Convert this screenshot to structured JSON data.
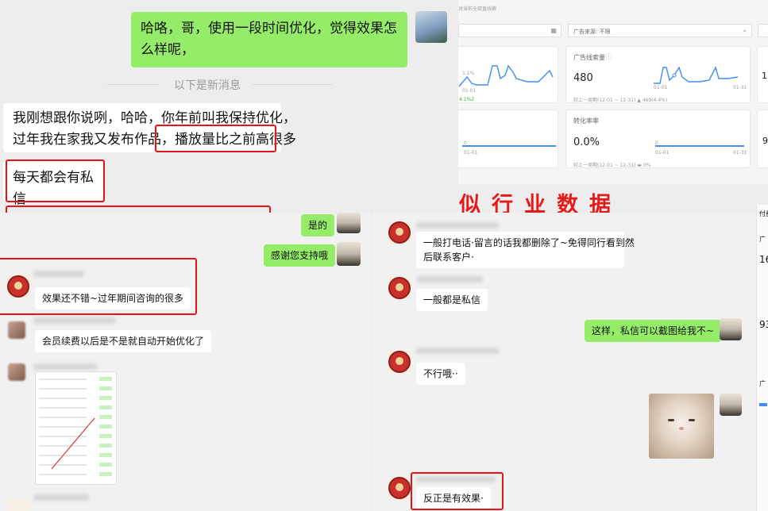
{
  "chat_top": {
    "outgoing": "哈咯，哥，使用一段时间优化，觉得效果怎么样呢，",
    "divider": "以下是新消息",
    "incoming_1_line1": "我刚想跟你说咧，哈哈，你年前叫我保持优化，",
    "incoming_1_line2": "过年我在家我又发布作品，",
    "incoming_1_highlight": "播放量比之前高很多",
    "incoming_2": "每天都会有私信"
  },
  "dashboard": {
    "header_text": "对当前全部直线索",
    "filter_label": "广告来源: 不限",
    "card_leads": {
      "title": "广告线索量",
      "value": "480",
      "compare": "较上一周期(12-01 ~ 12-31) ▲ 469(4.4%)",
      "date_start": "01-01",
      "date_end": "01-31"
    },
    "card_conversion": {
      "title": "转化率率",
      "value": "0.0%",
      "compare": "较上一周期(12-01 ~ 12-31) ▬ 0%",
      "axis_zero": "0",
      "date_start": "01-01",
      "date_end": "01-31"
    },
    "left_card_top_axis": "1.1%",
    "left_card_top_date": "01-01",
    "left_card_bottom_date": "01-01",
    "left_card_bottom_axis": "0",
    "left_card_compare": "4.1%2"
  },
  "banner_text": "似行业数据",
  "chat_left_bottom": {
    "top_partial": "是的",
    "thanks": "感谢您支持哦",
    "reply_1": "效果还不错~过年期间咨询的很多",
    "reply_2": "会员续费以后是不是就自动开始优化了"
  },
  "chat_right_bottom": {
    "msg_1_line1": "一般打电话·留言的话我都删除了~免得同行看到然",
    "msg_1_line2": "后联系客户·",
    "msg_2": "一般都是私信",
    "outgoing": "这样，私信可以截图给我不~",
    "msg_3": "不行哦··",
    "msg_4": "反正是有效果·"
  },
  "right_edge_fragments": {
    "top_label": "付费",
    "number_1": "16",
    "number_2": "93",
    "label_1": "广",
    "label_2": "广"
  },
  "colors": {
    "outgoing_bubble": "#95ec69",
    "incoming_bubble": "#ffffff",
    "highlight_red": "#e5141b",
    "chart_blue": "#3f8ef0"
  }
}
